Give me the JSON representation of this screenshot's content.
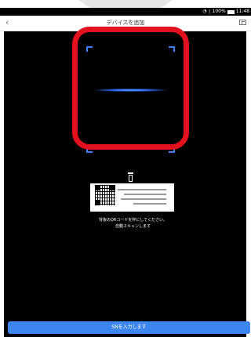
{
  "status_bar": {
    "battery_text": "100%",
    "time": "11:48"
  },
  "header": {
    "back_icon": "chevron-left-icon",
    "title": "デバイスを追加",
    "sn_icon": "sn-input-icon"
  },
  "scanner": {
    "instruction_line_1": "背後のQRコードを枠にしてください。",
    "instruction_line_2": "自動スキャンします"
  },
  "button": {
    "label": "SNを入力します"
  },
  "colors": {
    "accent": "#3d86ef",
    "highlight": "#e3101d",
    "scanner_blue": "#3d7fff"
  }
}
